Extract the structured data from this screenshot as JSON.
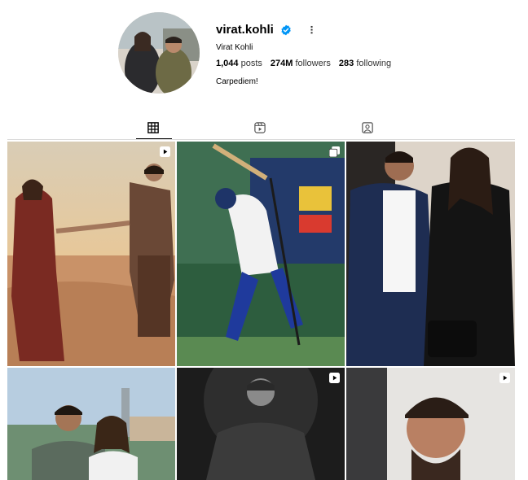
{
  "profile": {
    "username": "virat.kohli",
    "full_name": "Virat Kohli",
    "posts_count": "1,044",
    "posts_label": "posts",
    "followers_count": "274M",
    "followers_label": "followers",
    "following_count": "283",
    "following_label": "following",
    "bio": "Carpediem!",
    "verified_color": "#0095f6"
  },
  "tabs": [
    {
      "icon": "grid-icon",
      "active": true
    },
    {
      "icon": "reels-icon",
      "active": false
    },
    {
      "icon": "tagged-icon",
      "active": false
    }
  ],
  "posts": [
    {
      "type": "reel",
      "icon": "reel-icon"
    },
    {
      "type": "carousel",
      "icon": "carousel-icon"
    },
    {
      "type": "photo",
      "icon": ""
    },
    {
      "type": "photo",
      "icon": ""
    },
    {
      "type": "reel",
      "icon": "reel-icon"
    },
    {
      "type": "reel",
      "icon": "reel-icon"
    }
  ]
}
